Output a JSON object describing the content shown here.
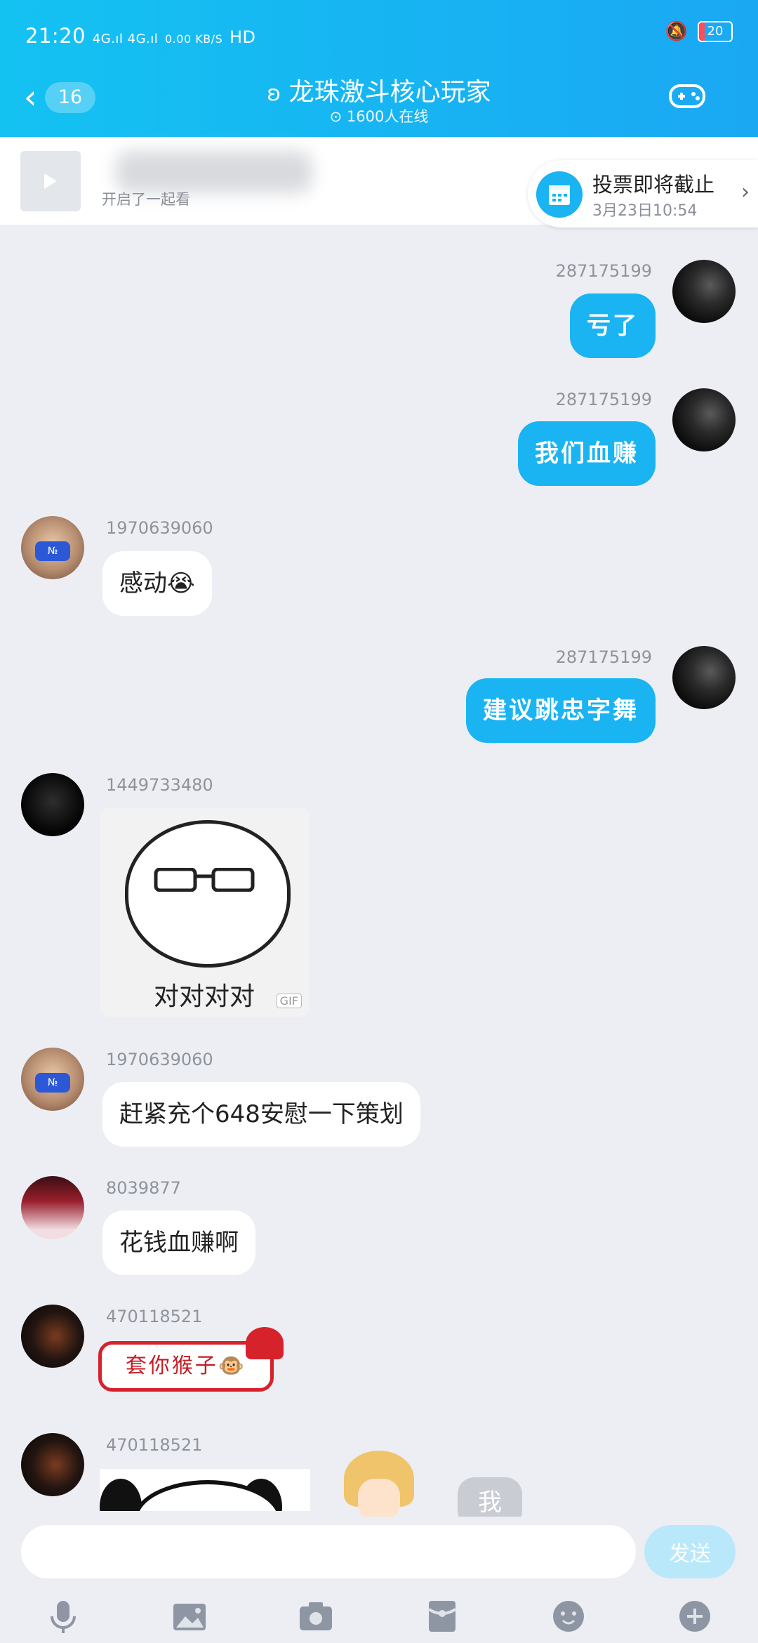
{
  "status_bar": {
    "time": "21:20",
    "signal": "4G.ıl 4G.ıl",
    "speed": "0.00 KB/S",
    "hd": "HD",
    "battery": "20"
  },
  "header": {
    "back_count": "16",
    "title": "龙珠激斗核心玩家",
    "online": "1600人在线"
  },
  "watch_bar": {
    "text": "开启了一起看"
  },
  "vote": {
    "title": "投票即将截止",
    "time": "3月23日10:54"
  },
  "messages": [
    {
      "uid": "287175199",
      "text": "亏了",
      "side": "me"
    },
    {
      "uid": "287175199",
      "text": "我们血赚",
      "side": "me"
    },
    {
      "uid": "1970639060",
      "text": "感动😭",
      "side": "other"
    },
    {
      "uid": "287175199",
      "text": "建议跳忠字舞",
      "side": "me"
    },
    {
      "uid": "1449733480",
      "sticker_text": "对对对对",
      "gif_tag": "GIF",
      "side": "other"
    },
    {
      "uid": "1970639060",
      "text": "赶紧充个648安慰一下策划",
      "side": "other"
    },
    {
      "uid": "8039877",
      "text": "花钱血赚啊",
      "side": "other"
    },
    {
      "uid": "470118521",
      "sticker_text": "套你猴子🐵",
      "side": "other"
    },
    {
      "uid": "470118521",
      "partial_text": "我",
      "side": "other"
    }
  ],
  "input": {
    "placeholder": "",
    "send_label": "发送"
  },
  "toolbar": [
    "mic-icon",
    "image-icon",
    "camera-icon",
    "red-packet-icon",
    "emoji-icon",
    "plus-icon"
  ],
  "colors": {
    "accent": "#1ab4f3",
    "header_start": "#14c2f2",
    "background": "#eceef4"
  }
}
